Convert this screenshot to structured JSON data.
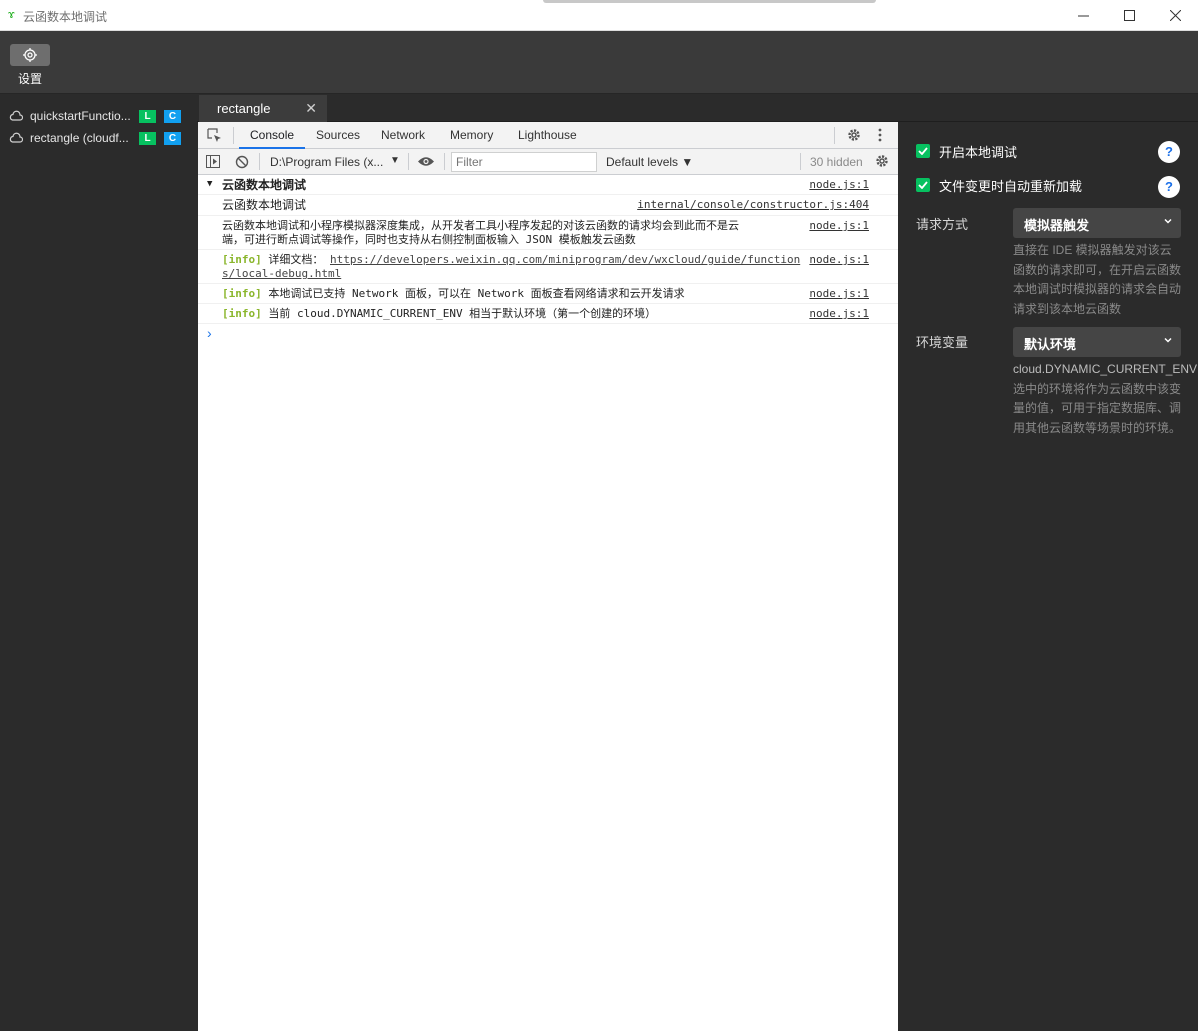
{
  "window": {
    "title": "云函数本地调试",
    "controls": [
      "minimize",
      "maximize",
      "close"
    ]
  },
  "toolbar": {
    "settings_label": "设置"
  },
  "sidebar": {
    "items": [
      {
        "name": "quickstartFunctio...",
        "badges": [
          "L",
          "C"
        ]
      },
      {
        "name": "rectangle (cloudf...",
        "badges": [
          "L",
          "C"
        ]
      }
    ]
  },
  "tabs": [
    {
      "label": "rectangle",
      "close": "✕"
    }
  ],
  "devtools": {
    "tabs": [
      "Console",
      "Sources",
      "Network",
      "Memory",
      "Lighthouse"
    ],
    "active_tab": "Console",
    "context": "D:\\Program Files (x...",
    "filter_placeholder": "Filter",
    "levels": "Default levels ▼",
    "hidden_count": "30 hidden",
    "messages": [
      {
        "group": "云函数本地调试",
        "src": "node.js:1"
      },
      {
        "text": "云函数本地调试",
        "src": "internal/console/constructor.js:404"
      },
      {
        "text_line1": "云函数本地调试和小程序模拟器深度集成，从开发者工具小程序发起的对该云函数的请求均会到此而不是云",
        "text_line2": "端，可进行断点调试等操作，同时也支持从右侧控制面板输入 JSON 模板触发云函数",
        "src": "node.js:1"
      },
      {
        "tag": "[info]",
        "text": "详细文档：",
        "url_line1": "https://developers.weixin.qq.com/miniprogram/dev/wxcloud/guide/function",
        "url_line2": "s/local-debug.html",
        "src": "node.js:1"
      },
      {
        "tag": "[info]",
        "text": "本地调试已支持 Network 面板，可以在 Network 面板查看网络请求和云开发请求",
        "src": "node.js:1"
      },
      {
        "tag": "[info]",
        "text": "当前 cloud.DYNAMIC_CURRENT_ENV 相当于默认环境（第一个创建的环境）",
        "src": "node.js:1"
      }
    ],
    "prompt": "›"
  },
  "panel": {
    "enable_local_debug": "开启本地调试",
    "auto_reload": "文件变更时自动重新加载",
    "help": "?",
    "request_label": "请求方式",
    "request_value": "模拟器触发",
    "request_desc": "直接在 IDE 模拟器触发对该云函数的请求即可，在开启云函数本地调试时模拟器的请求会自动请求到该本地云函数",
    "env_label": "环境变量",
    "env_value": "默认环境",
    "env_code": "cloud.DYNAMIC_CURRENT_ENV",
    "env_desc": "选中的环境将作为云函数中该变量的值，可用于指定数据库、调用其他云函数等场景时的环境。"
  },
  "colors": {
    "accent_green": "#07c160",
    "badge_blue": "#11a0f0",
    "info_green": "#8ab62c",
    "devtools_active": "#1a73e8"
  }
}
